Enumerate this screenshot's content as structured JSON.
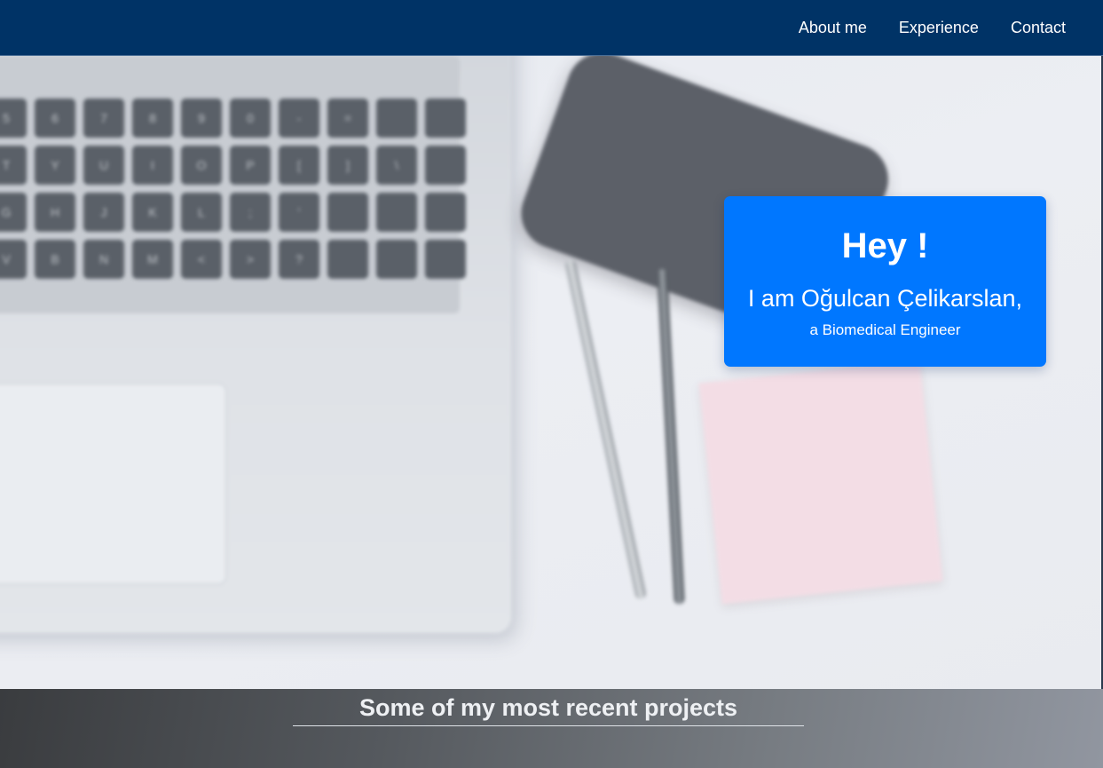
{
  "navbar": {
    "links": [
      {
        "label": "About me"
      },
      {
        "label": "Experience"
      },
      {
        "label": "Contact"
      }
    ],
    "background_color": "#003366"
  },
  "hero": {
    "background": "blurred desk photo with laptop, phone, pens and sticky note",
    "intro_card": {
      "greeting": "Hey !",
      "name_line": "I am Oğulcan Çelikarslan,",
      "role_line": "a Biomedical Engineer",
      "background_color": "#0077ff"
    }
  },
  "projects": {
    "title": "Some of my most recent projects"
  }
}
